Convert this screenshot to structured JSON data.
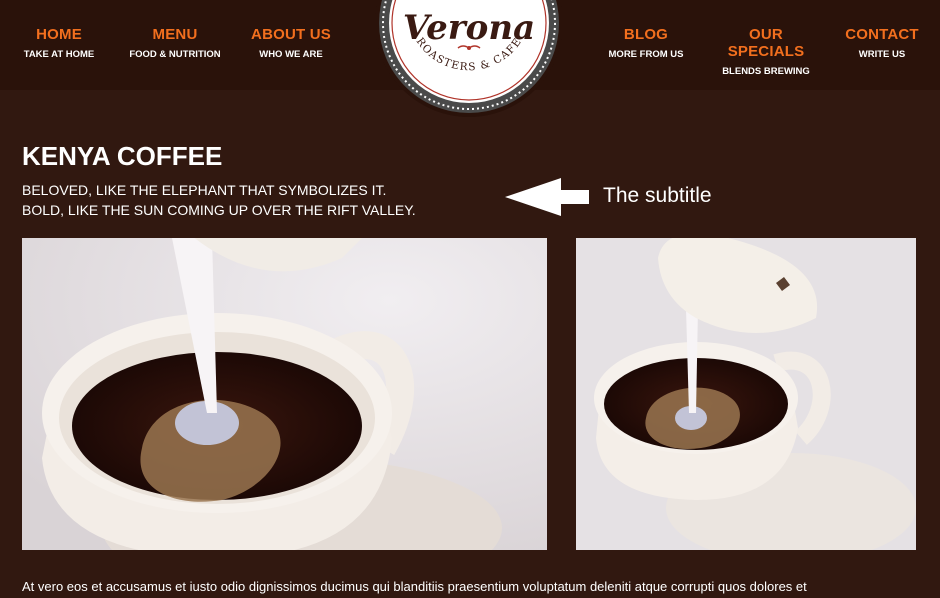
{
  "nav": {
    "left": [
      {
        "title": "HOME",
        "sub": "TAKE AT HOME"
      },
      {
        "title": "MENU",
        "sub": "FOOD & NUTRITION"
      },
      {
        "title": "ABOUT US",
        "sub": "WHO WE ARE"
      }
    ],
    "right": [
      {
        "title": "BLOG",
        "sub": "MORE FROM US"
      },
      {
        "title": "OUR SPECIALS",
        "sub": "BLENDS BREWING"
      },
      {
        "title": "CONTACT",
        "sub": "WRITE US"
      }
    ]
  },
  "logo": {
    "name": "Verona",
    "tagline": "ROASTERS & CAFE"
  },
  "page": {
    "title": "KENYA COFFEE",
    "subtitle_lines": [
      "BELOVED, LIKE THE ELEPHANT THAT SYMBOLIZES IT.",
      "BOLD, LIKE THE SUN COMING UP OVER THE RIFT VALLEY."
    ],
    "annotation": "The subtitle",
    "body": "At vero eos et accusamus et iusto odio dignissimos ducimus qui blanditiis praesentium voluptatum deleniti atque corrupti quos dolores et"
  },
  "colors": {
    "nav_accent": "#f26f1e",
    "background": "#311810",
    "header": "#2a120a"
  },
  "icons": {
    "annotation": "arrow-left-icon"
  }
}
